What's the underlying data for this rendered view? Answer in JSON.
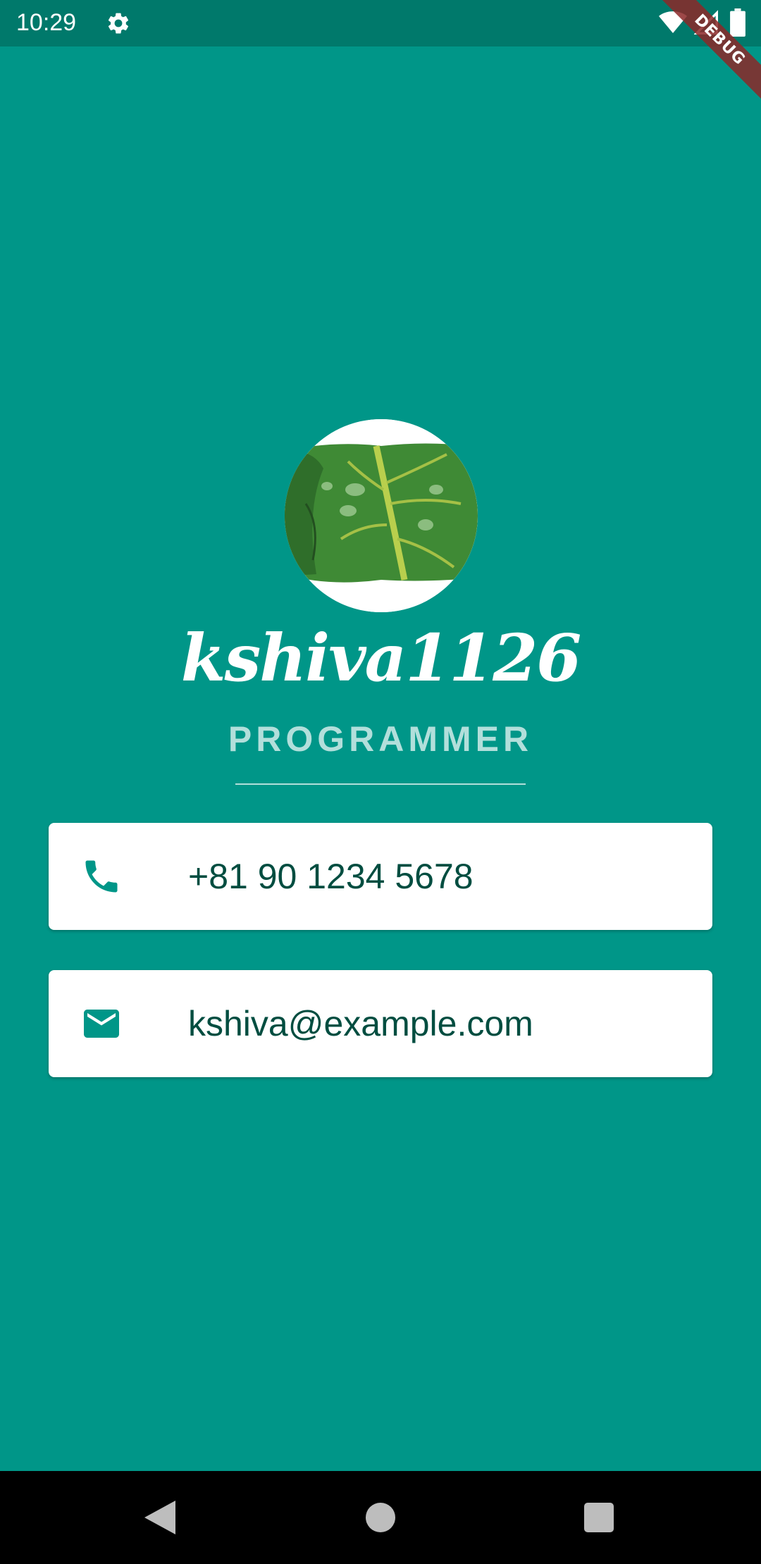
{
  "status_bar": {
    "time": "10:29",
    "icons": [
      "gear-icon",
      "wifi-icon",
      "signal-icon",
      "battery-icon"
    ]
  },
  "debug_banner": "DEBUG",
  "profile": {
    "avatar": "leaf-roll-avatar",
    "name": "kshiva1126",
    "title": "PROGRAMMER"
  },
  "contacts": {
    "phone": {
      "icon": "phone-icon",
      "value": "+81 90 1234 5678"
    },
    "email": {
      "icon": "mail-icon",
      "value": "kshiva@example.com"
    }
  },
  "nav_bar": {
    "buttons": [
      "back-icon",
      "home-icon",
      "recents-icon"
    ]
  },
  "colors": {
    "background": "#009688",
    "status_bar": "#00796b",
    "title_text": "#b2dfdb",
    "card_text": "#004d40",
    "icon": "#009688"
  }
}
